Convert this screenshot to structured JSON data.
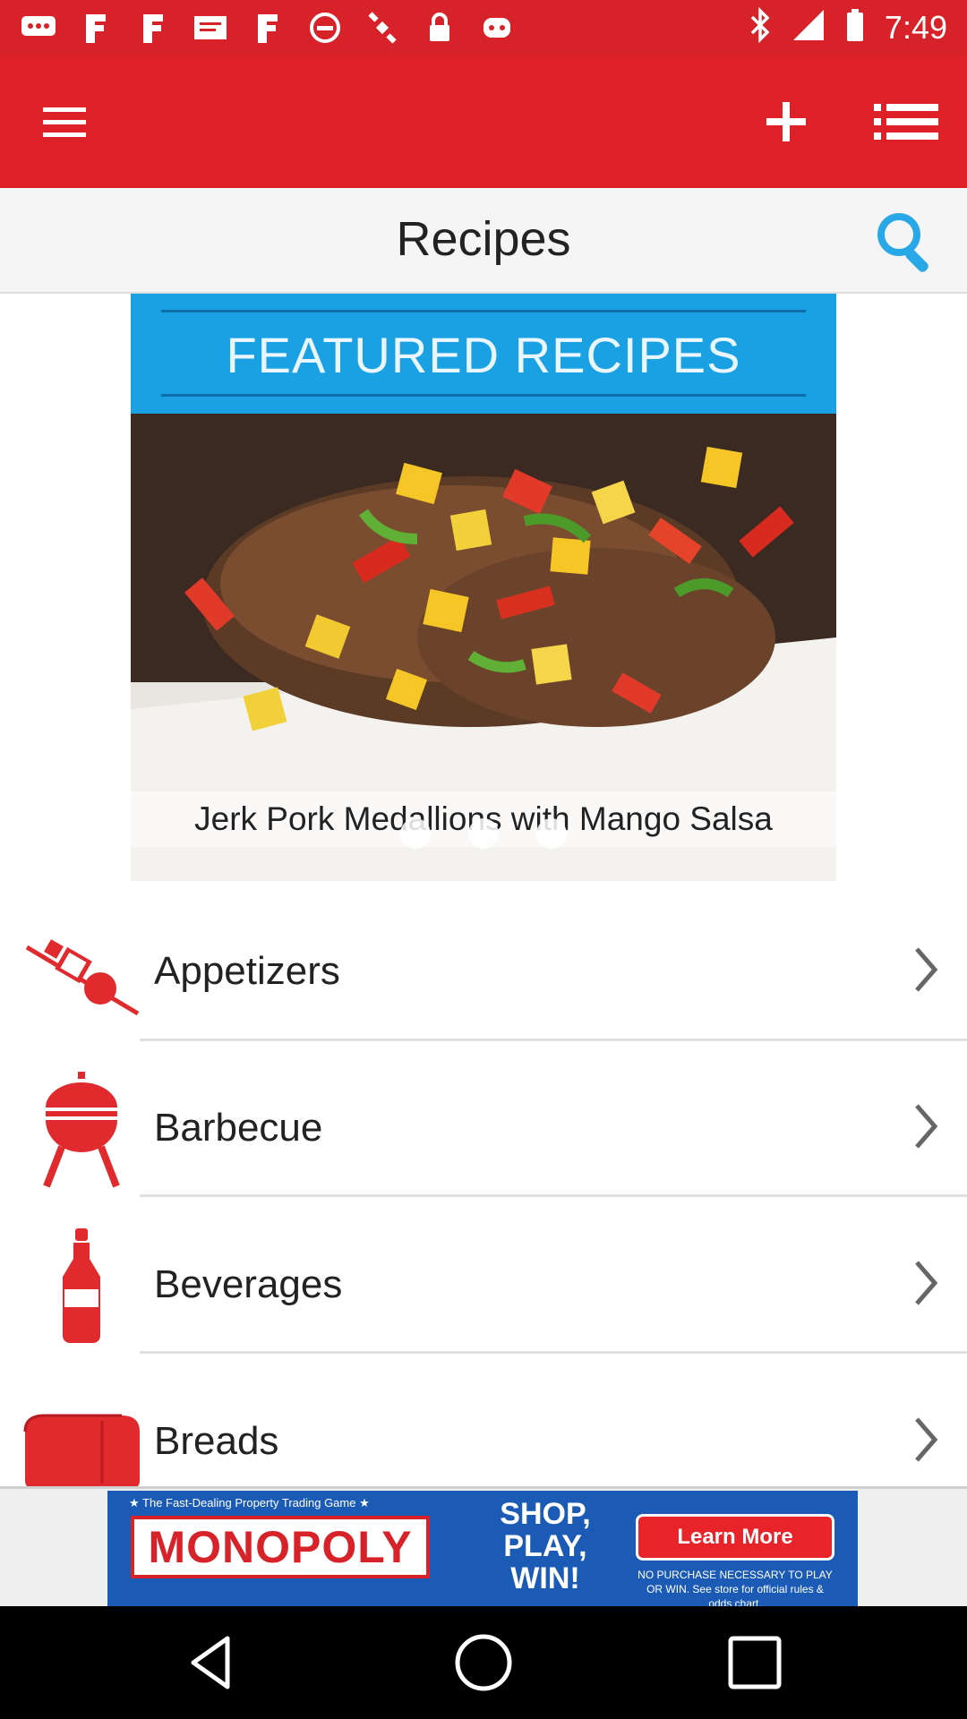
{
  "status_bar": {
    "time": "7:49",
    "left_icons": [
      "chat-icon",
      "fakebook-icon",
      "fakebook-icon",
      "message-icon",
      "fakebook-icon",
      "blocked-icon",
      "satellite-icon",
      "lock-icon",
      "game-icon"
    ],
    "right_icons": [
      "bluetooth-icon",
      "signal-icon",
      "battery-icon"
    ]
  },
  "app_bar": {
    "menu_icon": "hamburger-icon",
    "add_icon": "plus-icon",
    "list_icon": "list-icon"
  },
  "title_bar": {
    "title": "Recipes",
    "search_icon": "search-icon"
  },
  "featured": {
    "header": "FEATURED RECIPES",
    "caption": "Jerk Pork Medallions with Mango Salsa",
    "dots": 3
  },
  "categories": [
    {
      "label": "Appetizers",
      "icon": "skewer-icon"
    },
    {
      "label": "Barbecue",
      "icon": "grill-icon"
    },
    {
      "label": "Beverages",
      "icon": "bottle-icon"
    },
    {
      "label": "Breads",
      "icon": "bread-icon"
    }
  ],
  "ad": {
    "tagline": "★ The Fast-Dealing Property Trading Game ★",
    "brand": "MONOPOLY",
    "slogan": "SHOP, PLAY, WIN!",
    "cta": "Learn More",
    "fineprint": "NO PURCHASE NECESSARY TO PLAY OR WIN. See store for official rules & odds chart."
  },
  "colors": {
    "primary_red": "#de2128",
    "status_red": "#d62228",
    "featured_blue": "#1aa1e3",
    "icon_red": "#e02a2e",
    "search_blue": "#29a8e8"
  }
}
